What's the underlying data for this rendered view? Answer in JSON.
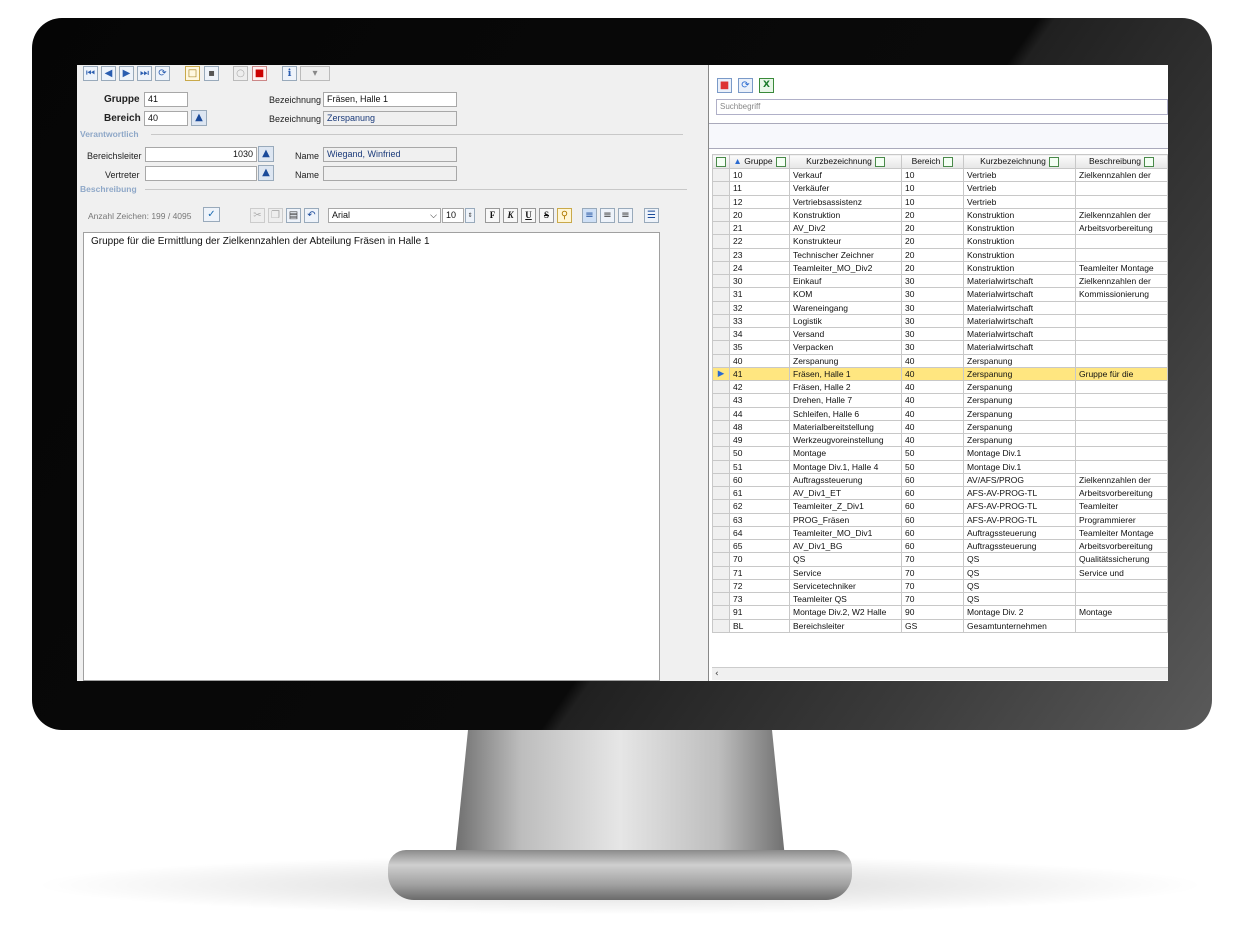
{
  "toolbar": {
    "first_icon": "first-record-icon",
    "prev_icon": "previous-record-icon",
    "next_icon": "next-record-icon",
    "last_icon": "last-record-icon",
    "refresh_icon": "refresh-icon",
    "new_icon": "new-record-icon",
    "save_icon": "save-icon",
    "delete_icon": "delete-icon"
  },
  "form": {
    "gruppe_label": "Gruppe",
    "gruppe_value": "41",
    "bezeichnung_label_1": "Bezeichnung",
    "bezeichnung_value_1": "Fräsen, Halle 1",
    "bereich_label": "Bereich",
    "bereich_value": "40",
    "bezeichnung_label_2": "Bezeichnung",
    "bezeichnung_value_2": "Zerspanung",
    "verantwortlich_section": "Verantwortlich",
    "bereichsleiter_label": "Bereichsleiter",
    "bereichsleiter_value": "1030",
    "name_label_1": "Name",
    "name_value_1": "Wiegand, Winfried",
    "vertreter_label": "Vertreter",
    "vertreter_value": "",
    "name_label_2": "Name",
    "name_value_2": "",
    "beschreibung_section": "Beschreibung"
  },
  "editor": {
    "char_count": "Anzahl Zeichen: 199 / 4095",
    "font_name": "Arial",
    "font_size": "10",
    "bold_label": "F",
    "italic_label": "K",
    "underline_label": "U",
    "strike_label": "S",
    "text": "Gruppe für die Ermittlung der Zielkennzahlen der Abteilung Fräsen in Halle 1"
  },
  "grid": {
    "search_placeholder": "Suchbegriff",
    "headers": [
      "Gruppe",
      "Kurzbezeichnung",
      "Bereich",
      "Kurzbezeichnung",
      "Beschreibung"
    ],
    "selected_index": 15,
    "rows": [
      [
        "10",
        "Verkauf",
        "10",
        "Vertrieb",
        "Zielkennzahlen der"
      ],
      [
        "11",
        "Verkäufer",
        "10",
        "Vertrieb",
        ""
      ],
      [
        "12",
        "Vertriebsassistenz",
        "10",
        "Vertrieb",
        ""
      ],
      [
        "20",
        "Konstruktion",
        "20",
        "Konstruktion",
        "Zielkennzahlen der"
      ],
      [
        "21",
        "AV_Div2",
        "20",
        "Konstruktion",
        "Arbeitsvorbereitung"
      ],
      [
        "22",
        "Konstrukteur",
        "20",
        "Konstruktion",
        ""
      ],
      [
        "23",
        "Technischer Zeichner",
        "20",
        "Konstruktion",
        ""
      ],
      [
        "24",
        "Teamleiter_MO_Div2",
        "20",
        "Konstruktion",
        "Teamleiter Montage"
      ],
      [
        "30",
        "Einkauf",
        "30",
        "Materialwirtschaft",
        "Zielkennzahlen der"
      ],
      [
        "31",
        "KOM",
        "30",
        "Materialwirtschaft",
        "Kommissionierung"
      ],
      [
        "32",
        "Wareneingang",
        "30",
        "Materialwirtschaft",
        ""
      ],
      [
        "33",
        "Logistik",
        "30",
        "Materialwirtschaft",
        ""
      ],
      [
        "34",
        "Versand",
        "30",
        "Materialwirtschaft",
        ""
      ],
      [
        "35",
        "Verpacken",
        "30",
        "Materialwirtschaft",
        ""
      ],
      [
        "40",
        "Zerspanung",
        "40",
        "Zerspanung",
        ""
      ],
      [
        "41",
        "Fräsen, Halle 1",
        "40",
        "Zerspanung",
        "Gruppe für die"
      ],
      [
        "42",
        "Fräsen, Halle 2",
        "40",
        "Zerspanung",
        ""
      ],
      [
        "43",
        "Drehen, Halle 7",
        "40",
        "Zerspanung",
        ""
      ],
      [
        "44",
        "Schleifen, Halle 6",
        "40",
        "Zerspanung",
        ""
      ],
      [
        "48",
        "Materialbereitstellung",
        "40",
        "Zerspanung",
        ""
      ],
      [
        "49",
        "Werkzeugvoreinstellung",
        "40",
        "Zerspanung",
        ""
      ],
      [
        "50",
        "Montage",
        "50",
        "Montage Div.1",
        ""
      ],
      [
        "51",
        "Montage Div.1, Halle 4",
        "50",
        "Montage Div.1",
        ""
      ],
      [
        "60",
        "Auftragssteuerung",
        "60",
        "AV/AFS/PROG",
        "Zielkennzahlen der"
      ],
      [
        "61",
        "AV_Div1_ET",
        "60",
        "AFS-AV-PROG-TL",
        "Arbeitsvorbereitung"
      ],
      [
        "62",
        "Teamleiter_Z_Div1",
        "60",
        "AFS-AV-PROG-TL",
        "Teamleiter"
      ],
      [
        "63",
        "PROG_Fräsen",
        "60",
        "AFS-AV-PROG-TL",
        "Programmierer"
      ],
      [
        "64",
        "Teamleiter_MO_Div1",
        "60",
        "Auftragssteuerung",
        "Teamleiter Montage"
      ],
      [
        "65",
        "AV_Div1_BG",
        "60",
        "Auftragssteuerung",
        "Arbeitsvorbereitung"
      ],
      [
        "70",
        "QS",
        "70",
        "QS",
        "Qualitätssicherung"
      ],
      [
        "71",
        "Service",
        "70",
        "QS",
        "Service und"
      ],
      [
        "72",
        "Servicetechniker",
        "70",
        "QS",
        ""
      ],
      [
        "73",
        "Teamleiter QS",
        "70",
        "QS",
        ""
      ],
      [
        "91",
        "Montage Div.2, W2 Halle",
        "90",
        "Montage Div. 2",
        "Montage"
      ],
      [
        "BL",
        "Bereichsleiter",
        "GS",
        "Gesamtunternehmen",
        ""
      ]
    ]
  }
}
